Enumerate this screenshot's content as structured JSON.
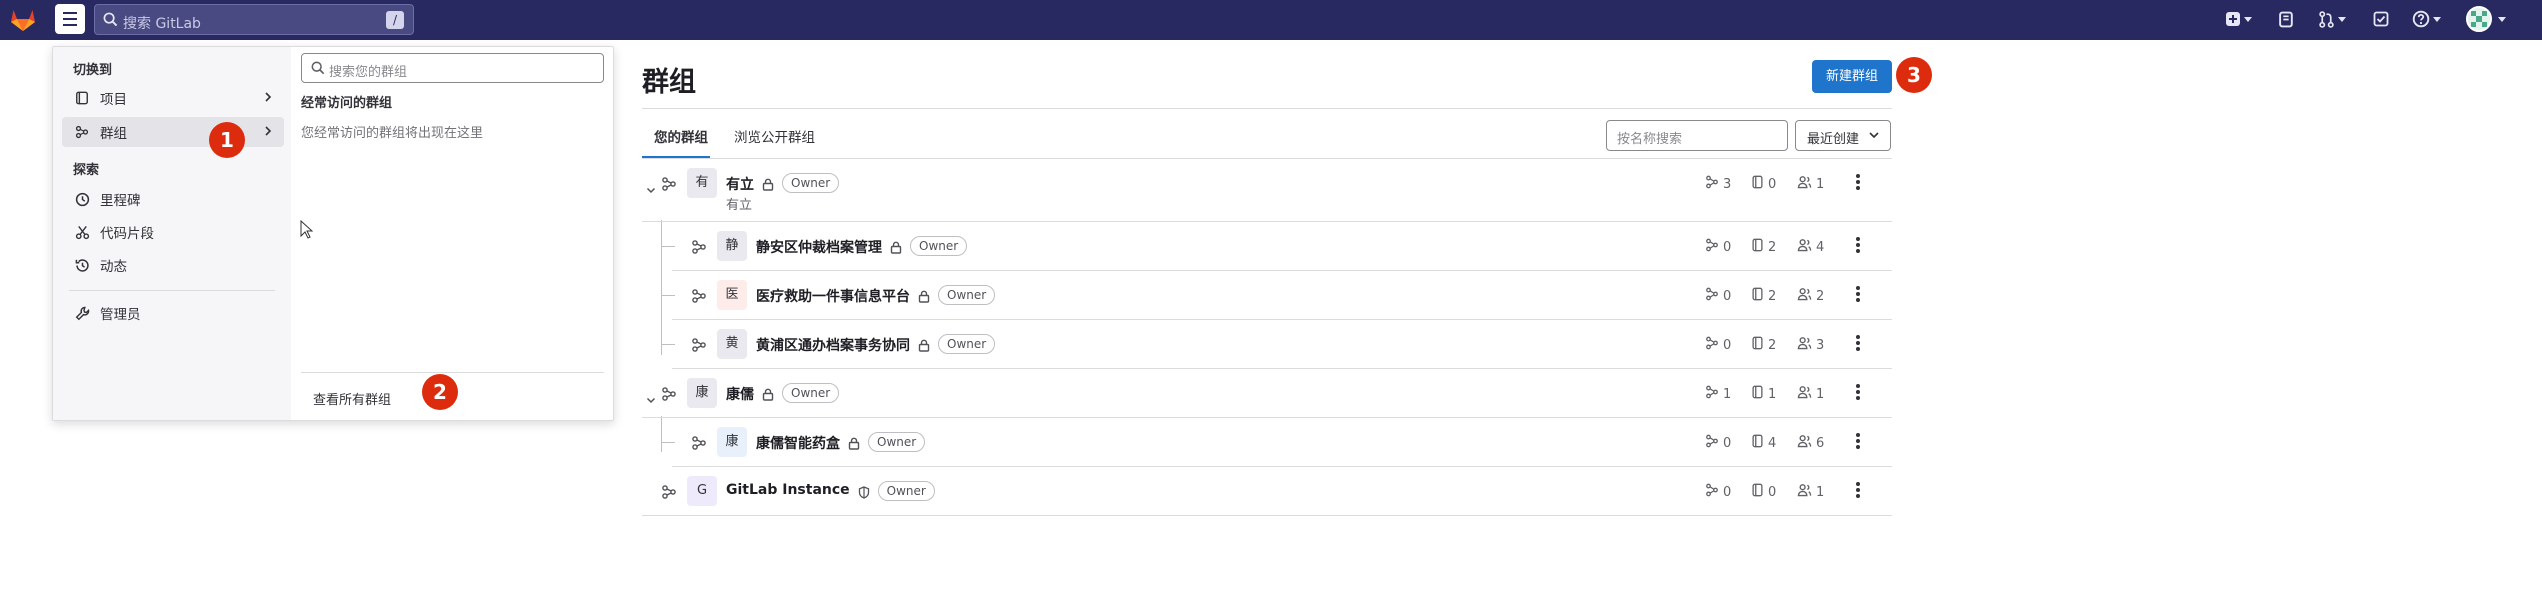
{
  "topbar": {
    "search_placeholder": "搜索 GitLab",
    "search_shortcut": "/"
  },
  "flyout": {
    "switch_to": "切换到",
    "nav_projects": "项目",
    "nav_groups": "群组",
    "explore": "探索",
    "nav_milestones": "里程碑",
    "nav_snippets": "代码片段",
    "nav_activity": "动态",
    "nav_admin": "管理员",
    "search_placeholder": "搜索您的群组",
    "frequent_title": "经常访问的群组",
    "frequent_empty": "您经常访问的群组将出现在这里",
    "view_all": "查看所有群组"
  },
  "callouts": {
    "one": "1",
    "two": "2",
    "three": "3"
  },
  "main": {
    "title": "群组",
    "new_group": "新建群组",
    "tab_yours": "您的群组",
    "tab_public": "浏览公开群组",
    "filter_placeholder": "按名称搜索",
    "sort_label": "最近创建"
  },
  "groups": [
    {
      "avatar": "有",
      "name": "有立",
      "description": "有立",
      "role": "Owner",
      "subgroups": "3",
      "projects": "0",
      "members": "1"
    },
    {
      "avatar": "静",
      "name": "静安区仲裁档案管理",
      "role": "Owner",
      "subgroups": "0",
      "projects": "2",
      "members": "4"
    },
    {
      "avatar": "医",
      "name": "医疗救助一件事信息平台",
      "role": "Owner",
      "subgroups": "0",
      "projects": "2",
      "members": "2"
    },
    {
      "avatar": "黄",
      "name": "黄浦区通办档案事务协同",
      "role": "Owner",
      "subgroups": "0",
      "projects": "2",
      "members": "3"
    },
    {
      "avatar": "康",
      "name": "康儒",
      "role": "Owner",
      "subgroups": "1",
      "projects": "1",
      "members": "1"
    },
    {
      "avatar": "康",
      "name": "康儒智能药盒",
      "role": "Owner",
      "subgroups": "0",
      "projects": "4",
      "members": "6"
    },
    {
      "avatar": "G",
      "name": "GitLab Instance",
      "role": "Owner",
      "subgroups": "0",
      "projects": "0",
      "members": "1"
    }
  ],
  "colors": {
    "navbar": "#292961",
    "primary": "#1f75cb",
    "callout": "#dd2b0e"
  }
}
